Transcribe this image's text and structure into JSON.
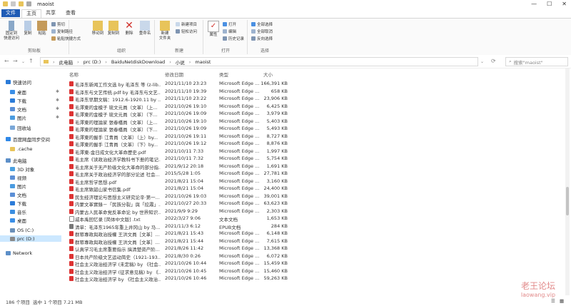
{
  "window": {
    "title": "maoist",
    "controls": [
      "—",
      "☐",
      "✕"
    ]
  },
  "ribbon_tabs": [
    "文件",
    "主页",
    "共享",
    "查看"
  ],
  "ribbon": {
    "clipboard": {
      "label": "剪贴板",
      "pin": "固定到\n快速访问",
      "copy": "复制",
      "paste": "粘贴",
      "cut": "剪切",
      "copy_path": "复制路径",
      "paste_shortcut": "粘贴快捷方式"
    },
    "organize": {
      "label": "组织",
      "move_to": "移动到",
      "copy_to": "复制到",
      "delete": "删除",
      "rename": "重命名"
    },
    "new": {
      "label": "新建",
      "new_folder": "新建\n文件夹",
      "new_item": "新建项目",
      "easy_access": "轻松访问"
    },
    "open": {
      "label": "打开",
      "properties": "属性",
      "open": "打开",
      "edit": "编辑",
      "history": "历史记录"
    },
    "select": {
      "label": "选择",
      "select_all": "全部选择",
      "select_none": "全部取消",
      "invert": "反向选择"
    }
  },
  "address": {
    "crumbs": [
      "此电脑",
      "prc (D:)",
      "BaiduNetdiskDownload",
      "小说",
      "maoist"
    ],
    "search_placeholder": "搜索\"maoist\""
  },
  "nav": [
    {
      "label": "快速访问",
      "color": "#2b7bd8"
    },
    {
      "label": "桌面",
      "color": "#3a8ee6",
      "pin": true
    },
    {
      "label": "下载",
      "color": "#2b7bd8",
      "pin": true
    },
    {
      "label": "文档",
      "color": "#5b8fd6",
      "pin": true
    },
    {
      "label": "图片",
      "color": "#4a9be0",
      "pin": true
    },
    {
      "label": "回收站",
      "color": "#7aa7d8"
    },
    {
      "label": "百度网盘同步空间",
      "color": "#2f88e8"
    },
    {
      "label": ".cache",
      "color": "#e8c45a"
    },
    {
      "label": "此电脑",
      "color": "#5d8fc8"
    },
    {
      "label": "3D 对象",
      "color": "#4aa0e0"
    },
    {
      "label": "视频",
      "color": "#5b8fd6"
    },
    {
      "label": "图片",
      "color": "#4a9be0"
    },
    {
      "label": "文档",
      "color": "#5b8fd6"
    },
    {
      "label": "下载",
      "color": "#2b7bd8"
    },
    {
      "label": "音乐",
      "color": "#3b8ee0"
    },
    {
      "label": "桌面",
      "color": "#3a8ee6"
    },
    {
      "label": "OS (C:)",
      "color": "#6a8fb8"
    },
    {
      "label": "prc (D:)",
      "color": "#8a8a8a",
      "selected": true
    },
    {
      "label": "Network",
      "color": "#5d8fc8"
    }
  ],
  "columns": {
    "name": "名称",
    "date": "修改日期",
    "type": "类型",
    "size": "大小"
  },
  "files": [
    {
      "name": "毛泽东新闻工作文选 by 毛泽东 等 (z-lib...",
      "date": "2021/11/10 23:23",
      "type": "Microsoft Edge ...",
      "size": "166,391 KB",
      "icon": "pdf"
    },
    {
      "name": "毛泽东与文艺传统.pdf by 毛泽东与文艺...",
      "date": "2021/11/10 19:39",
      "type": "Microsoft Edge ...",
      "size": "658 KB",
      "icon": "pdf"
    },
    {
      "name": "毛泽东早期文稿：1912.6-1920.11 by ...",
      "date": "2021/11/10 23:22",
      "type": "Microsoft Edge ...",
      "size": "23,906 KB",
      "icon": "pdf"
    },
    {
      "name": "毛澤東的金模子 琉文元員（文革）（上...",
      "date": "2021/10/26 19:10",
      "type": "Microsoft Edge ...",
      "size": "6,425 KB",
      "icon": "pdf"
    },
    {
      "name": "毛澤東的金模子 琉文元員（文革）（下...",
      "date": "2021/10/26 19:09",
      "type": "Microsoft Edge ...",
      "size": "3,979 KB",
      "icon": "pdf"
    },
    {
      "name": "毛澤東的理論家 張春橋員（文革）（上...",
      "date": "2021/10/26 19:10",
      "type": "Microsoft Edge ...",
      "size": "5,403 KB",
      "icon": "pdf"
    },
    {
      "name": "毛澤東的理論家 張春橋員（文革）（下...",
      "date": "2021/10/26 19:09",
      "type": "Microsoft Edge ...",
      "size": "5,493 KB",
      "icon": "pdf"
    },
    {
      "name": "毛澤東的握手 江青員（文革）（上）by...",
      "date": "2021/10/26 19:11",
      "type": "Microsoft Edge ...",
      "size": "8,727 KB",
      "icon": "pdf"
    },
    {
      "name": "毛澤東的握手 江青員（文革）（下）by...",
      "date": "2021/10/26 19:12",
      "type": "Microsoft Edge ...",
      "size": "8,876 KB",
      "icon": "pdf"
    },
    {
      "name": "毛澤東-金日成文化大革命歷史.pdf",
      "date": "2021/10/11 7:33",
      "type": "Microsoft Edge ...",
      "size": "1,997 KB",
      "icon": "pdf"
    },
    {
      "name": "毛主席《读政治经济学教科书下册的笔记...",
      "date": "2021/10/11 7:32",
      "type": "Microsoft Edge ...",
      "size": "5,754 KB",
      "icon": "pdf"
    },
    {
      "name": "毛主席关于无产阶级文化大革命的部分指...",
      "date": "2021/9/12 20:18",
      "type": "Microsoft Edge ...",
      "size": "1,691 KB",
      "icon": "pdf"
    },
    {
      "name": "毛主席关于政治经济学的部分论述 社会...",
      "date": "2015/5/28 1:05",
      "type": "Microsoft Edge ...",
      "size": "27,781 KB",
      "icon": "pdf"
    },
    {
      "name": "毛主席哲学思想.pdf",
      "date": "2021/8/21 15:04",
      "type": "Microsoft Edge ...",
      "size": "3,160 KB",
      "icon": "pdf"
    },
    {
      "name": "毛主席致韶山家书信集.pdf",
      "date": "2021/8/21 15:04",
      "type": "Microsoft Edge ...",
      "size": "24,400 KB",
      "icon": "pdf"
    },
    {
      "name": "民生经济理论与思想主义研究论辛·第一...",
      "date": "2021/10/26 19:03",
      "type": "Microsoft Edge ...",
      "size": "39,001 KB",
      "icon": "pdf"
    },
    {
      "name": "内蒙文革實錄－「民族分裂」與「挖肅」...",
      "date": "2021/10/27 20:33",
      "type": "Microsoft Edge ...",
      "size": "63,623 KB",
      "icon": "pdf"
    },
    {
      "name": "内蒙古人民革命党反革命论 by 世界知识...",
      "date": "2021/9/9 9:29",
      "type": "Microsoft Edge ...",
      "size": "2,303 KB",
      "icon": "pdf"
    },
    {
      "name": "戚本禹回忆录 [简体中文版] .txt",
      "date": "2022/3/27 9:06",
      "type": "文本文档",
      "size": "1,653 KB",
      "icon": "txt"
    },
    {
      "name": "清单：毛泽东1965年重上井冈山 by 马...",
      "date": "2021/11/3 6:12",
      "type": "EPUB文档",
      "size": "284 KB",
      "icon": "epub"
    },
    {
      "name": "群眾專政與政治授權 王洪文員［文革］...",
      "date": "2021/8/21 15:43",
      "type": "Microsoft Edge ...",
      "size": "6,148 KB",
      "icon": "pdf"
    },
    {
      "name": "群眾專政與政治授權 王洪文員［文革］...",
      "date": "2021/8/21 15:44",
      "type": "Microsoft Edge ...",
      "size": "7,615 KB",
      "icon": "pdf"
    },
    {
      "name": "认真学习毛主席重要指示 搞清楚资产阶...",
      "date": "2021/8/26 11:42",
      "type": "Microsoft Edge ...",
      "size": "13,368 KB",
      "icon": "pdf"
    },
    {
      "name": "日本共产阶级文艺运动简史（1921-193...",
      "date": "2021/8/30 0:26",
      "type": "Microsoft Edge ...",
      "size": "6,072 KB",
      "icon": "pdf"
    },
    {
      "name": "社会主义政治经济学 (未定稿) by 《社会...",
      "date": "2021/10/26 10:44",
      "type": "Microsoft Edge ...",
      "size": "15,459 KB",
      "icon": "pdf"
    },
    {
      "name": "社会主义政治经济学 (征求意见稿) by 《...",
      "date": "2021/10/26 10:45",
      "type": "Microsoft Edge ...",
      "size": "15,460 KB",
      "icon": "pdf"
    },
    {
      "name": "社会主义政治经济学 by 《社会主义政治...",
      "date": "2021/10/26 10:46",
      "type": "Microsoft Edge ...",
      "size": "59,263 KB",
      "icon": "pdf"
    }
  ],
  "status": {
    "count": "186 个项目",
    "selected": "选中 1 个项目 7.21 MB"
  },
  "watermark": {
    "line1": "老王论坛",
    "line2": "laowang.vip"
  }
}
